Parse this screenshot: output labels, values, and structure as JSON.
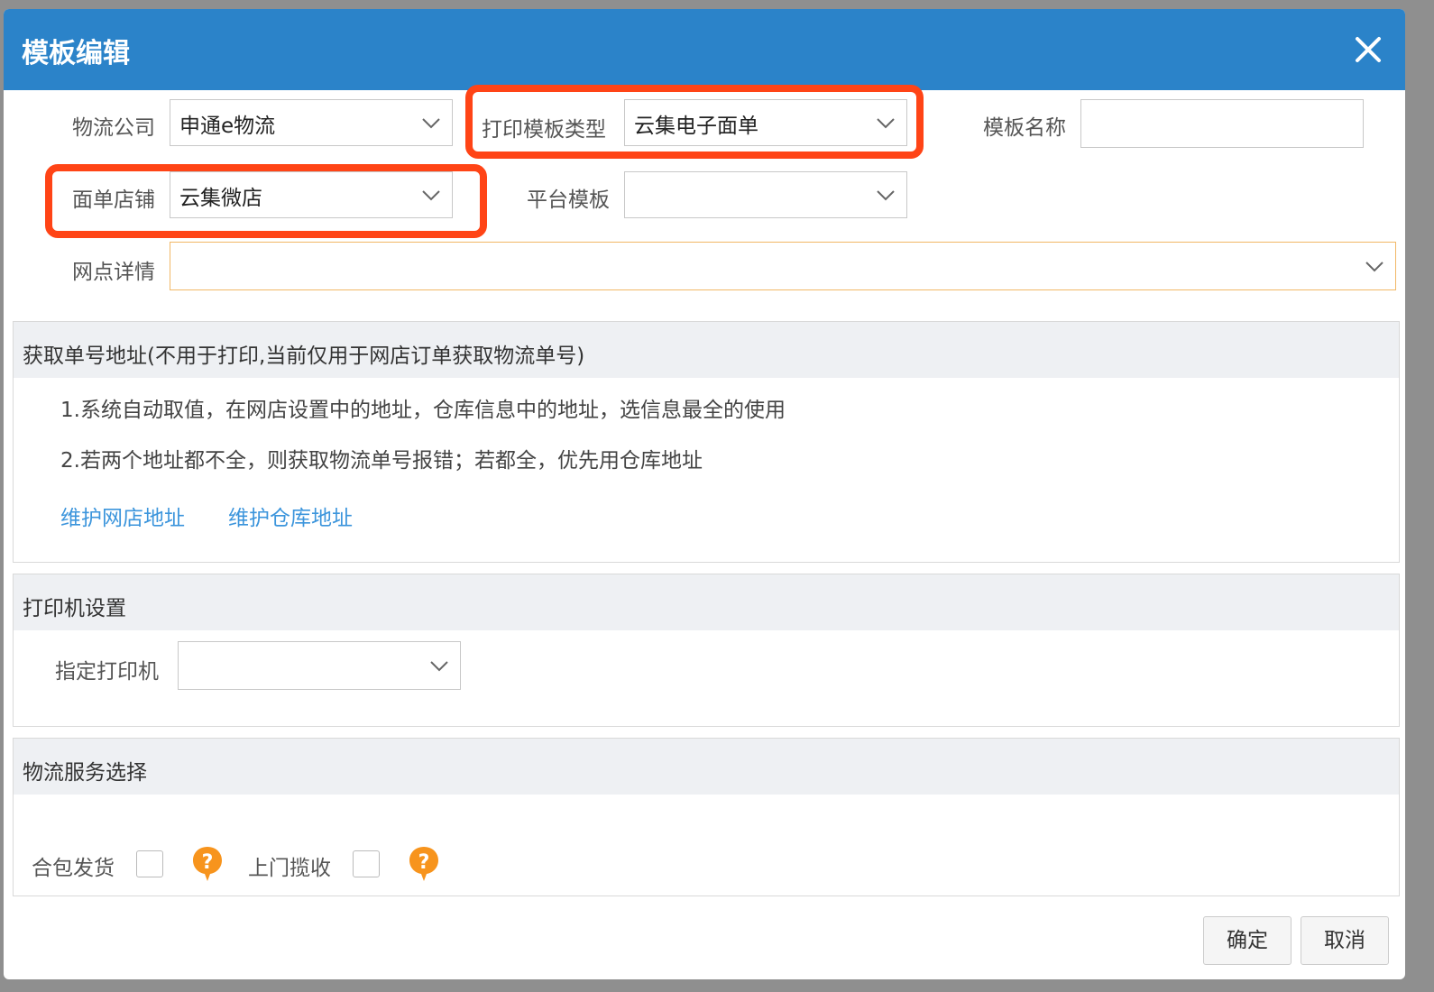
{
  "dialog": {
    "title": "模板编辑",
    "close_icon": "close-icon",
    "colors": {
      "titlebar": "#2b83c9",
      "highlight": "#ff4416",
      "link": "#3c95dc",
      "focus_border": "#f2b866"
    }
  },
  "form": {
    "logistics_company": {
      "label": "物流公司",
      "value": "申通e物流"
    },
    "print_template_type": {
      "label": "打印模板类型",
      "value": "云集电子面单"
    },
    "template_name": {
      "label": "模板名称",
      "value": ""
    },
    "waybill_shop": {
      "label": "面单店铺",
      "value": "云集微店"
    },
    "platform_template": {
      "label": "平台模板",
      "value": ""
    },
    "outlet_details": {
      "label": "网点详情",
      "value": ""
    }
  },
  "address_section": {
    "header": "获取单号地址(不用于打印,当前仅用于网店订单获取物流单号)",
    "note1": "1.系统自动取值，在网店设置中的地址，仓库信息中的地址，选信息最全的使用",
    "note2": "2.若两个地址都不全，则获取物流单号报错；若都全，优先用仓库地址",
    "link_shop": "维护网店地址",
    "link_warehouse": "维护仓库地址"
  },
  "printer_section": {
    "header": "打印机设置",
    "printer_label": "指定打印机",
    "printer_value": ""
  },
  "service_section": {
    "header": "物流服务选择",
    "option1": {
      "label": "合包发货",
      "checked": false
    },
    "option2": {
      "label": "上门揽收",
      "checked": false
    },
    "help_icon": "help-icon"
  },
  "footer": {
    "ok": "确定",
    "cancel": "取消"
  }
}
